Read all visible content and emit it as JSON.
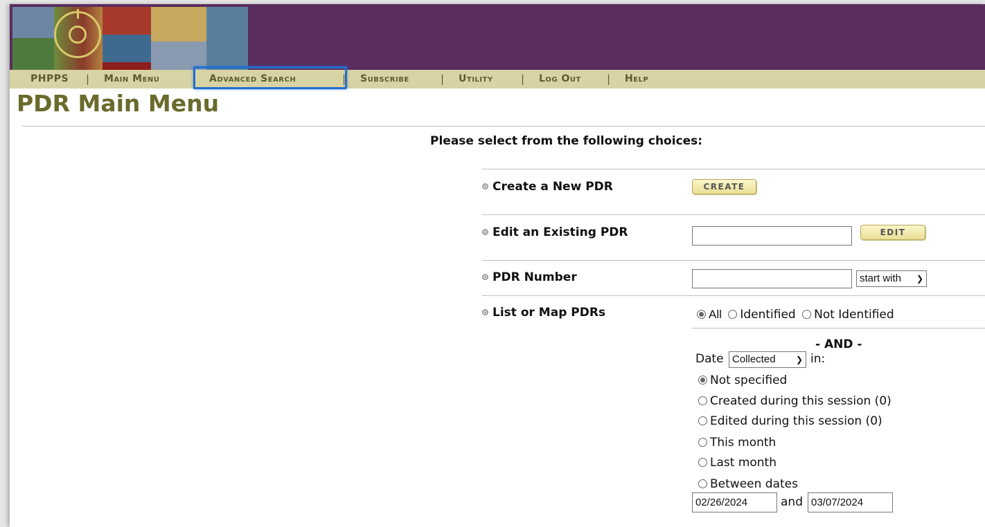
{
  "nav": {
    "items": [
      "PHPPS",
      "Main Menu",
      "Advanced Search",
      "Subscribe",
      "Utility",
      "Log Out",
      "Help"
    ],
    "separator": "|"
  },
  "page_title": "PDR Main Menu",
  "instruction": "Please select from the following choices:",
  "rows": {
    "create": {
      "label": "Create a New PDR",
      "button": "CREATE"
    },
    "edit": {
      "label": "Edit an Existing PDR",
      "value": "",
      "button": "EDIT"
    },
    "number": {
      "label": "PDR Number",
      "value": "",
      "select": "start with"
    },
    "list": {
      "label": "List or Map PDRs",
      "filter_options": [
        "All",
        "Identified",
        "Not Identified"
      ],
      "filter_selected": "All",
      "and_label": "- AND -",
      "date_label": "Date",
      "date_select": "Collected",
      "in_label": "in:",
      "periods": [
        "Not specified",
        "Created during this session (0)",
        "Edited during this session (0)",
        "This month",
        "Last month",
        "Between dates"
      ],
      "period_selected": "Not specified",
      "date_from": "02/26/2024",
      "between_and": "and",
      "date_to": "03/07/2024"
    }
  },
  "colors": {
    "banner": "#5b2d5e",
    "navbar": "#d8d3a4",
    "nav_text": "#5e5a2a",
    "title": "#6a6a2c",
    "highlight": "#1e6fd0"
  }
}
